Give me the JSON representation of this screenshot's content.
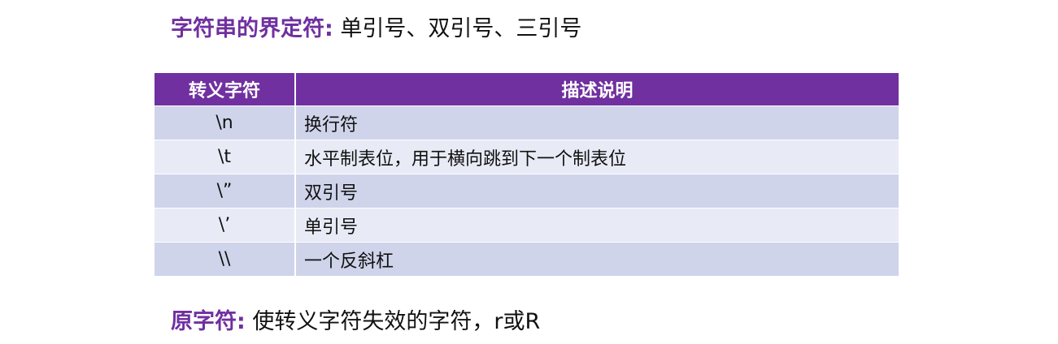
{
  "delimiters": {
    "label": "字符串的界定符:",
    "text": "单引号、双引号、三引号"
  },
  "table": {
    "headers": [
      "转义字符",
      "描述说明"
    ],
    "rows": [
      {
        "escape": "\\n",
        "description": "换行符"
      },
      {
        "escape": "\\t",
        "description": "水平制表位，用于横向跳到下一个制表位"
      },
      {
        "escape": "\\”",
        "description": "双引号"
      },
      {
        "escape": "\\’",
        "description": "单引号"
      },
      {
        "escape": "\\\\",
        "description": "一个反斜杠"
      }
    ]
  },
  "raw_string": {
    "label": "原字符:",
    "text": "使转义字符失效的字符，r或R"
  },
  "colors": {
    "accent": "#7030a0",
    "row_dark": "#cfd4ea",
    "row_light": "#e8ebf5"
  }
}
